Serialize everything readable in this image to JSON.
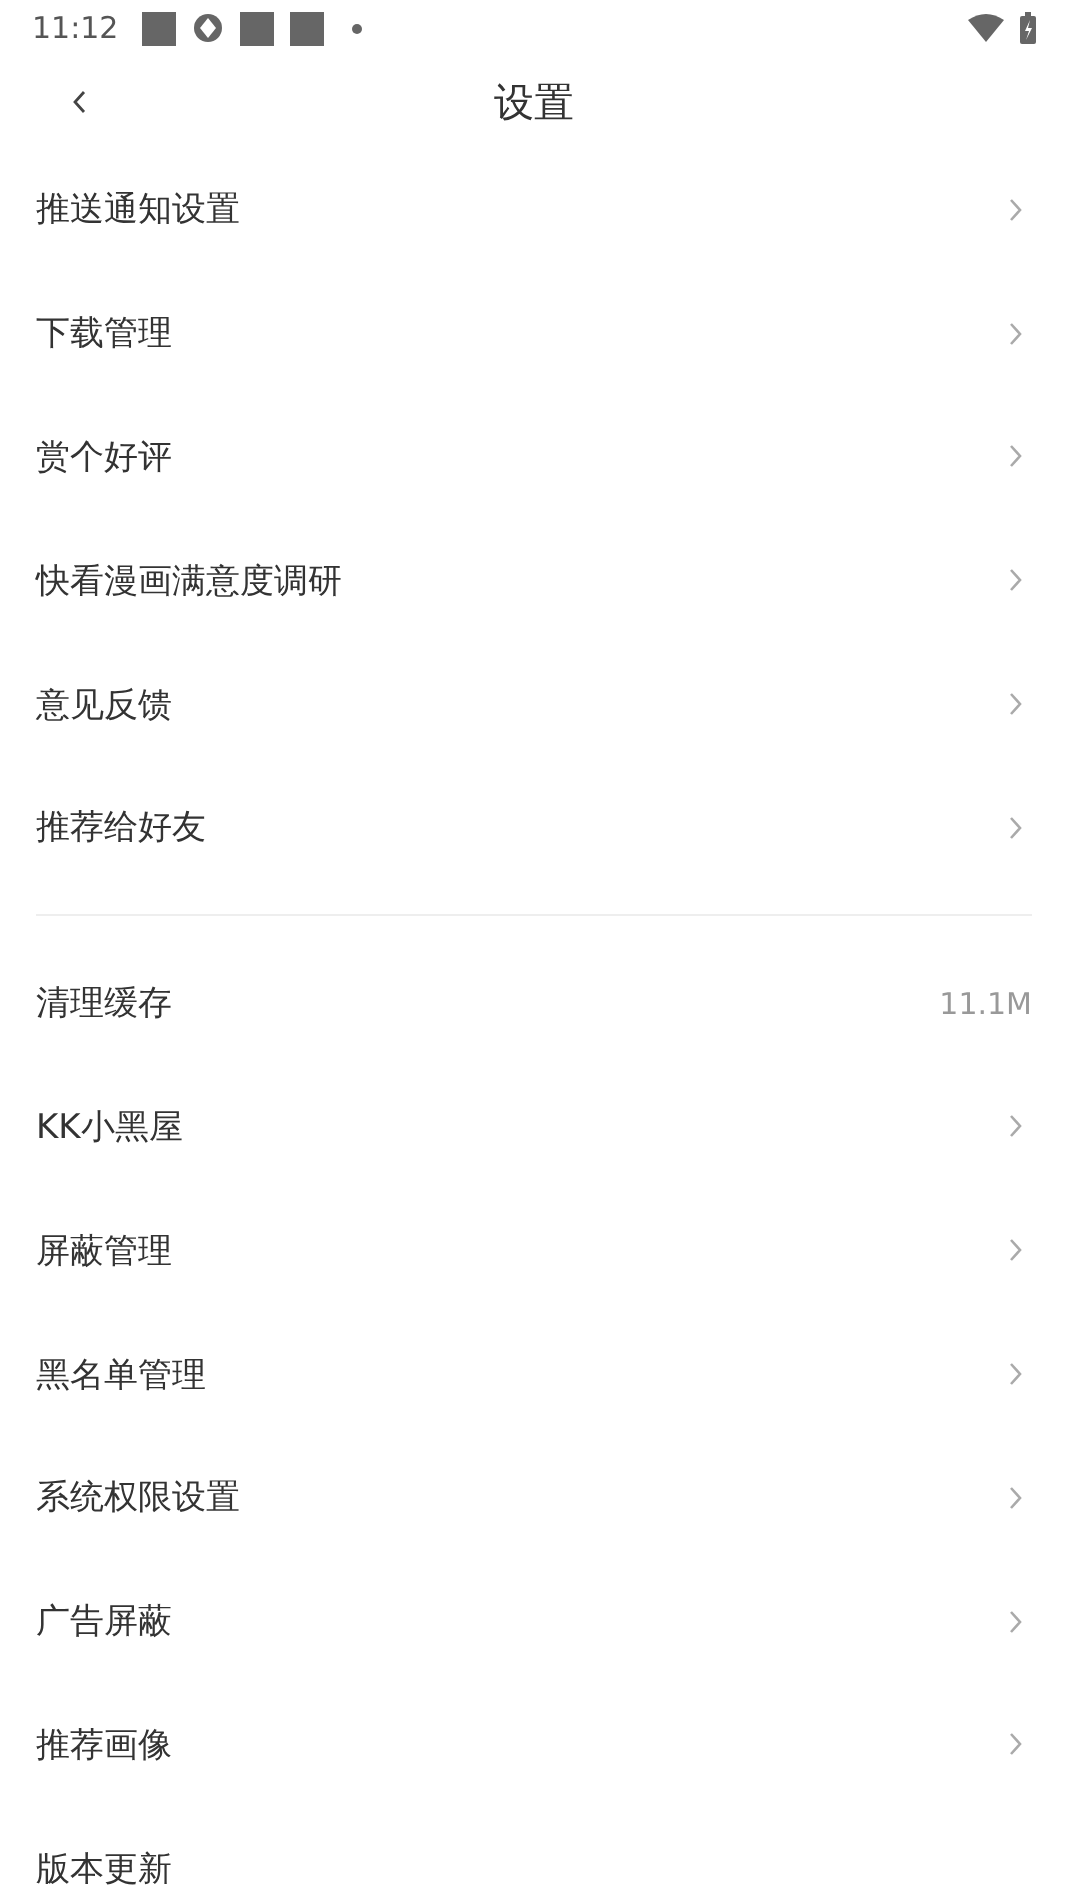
{
  "status_bar": {
    "time": "11:12"
  },
  "header": {
    "title": "设置"
  },
  "groups": [
    {
      "items": [
        {
          "label": "推送通知设置",
          "kind": "chevron"
        },
        {
          "label": "下载管理",
          "kind": "chevron"
        },
        {
          "label": "赏个好评",
          "kind": "chevron"
        },
        {
          "label": "快看漫画满意度调研",
          "kind": "chevron"
        },
        {
          "label": "意见反馈",
          "kind": "chevron"
        },
        {
          "label": "推荐给好友",
          "kind": "chevron"
        }
      ]
    },
    {
      "items": [
        {
          "label": "清理缓存",
          "kind": "value",
          "value": "11.1M"
        },
        {
          "label": "KK小黑屋",
          "kind": "chevron"
        },
        {
          "label": "屏蔽管理",
          "kind": "chevron"
        },
        {
          "label": "黑名单管理",
          "kind": "chevron"
        },
        {
          "label": "系统权限设置",
          "kind": "chevron"
        },
        {
          "label": "广告屏蔽",
          "kind": "chevron"
        },
        {
          "label": "推荐画像",
          "kind": "chevron"
        },
        {
          "label": "版本更新",
          "kind": "plain"
        }
      ]
    }
  ]
}
